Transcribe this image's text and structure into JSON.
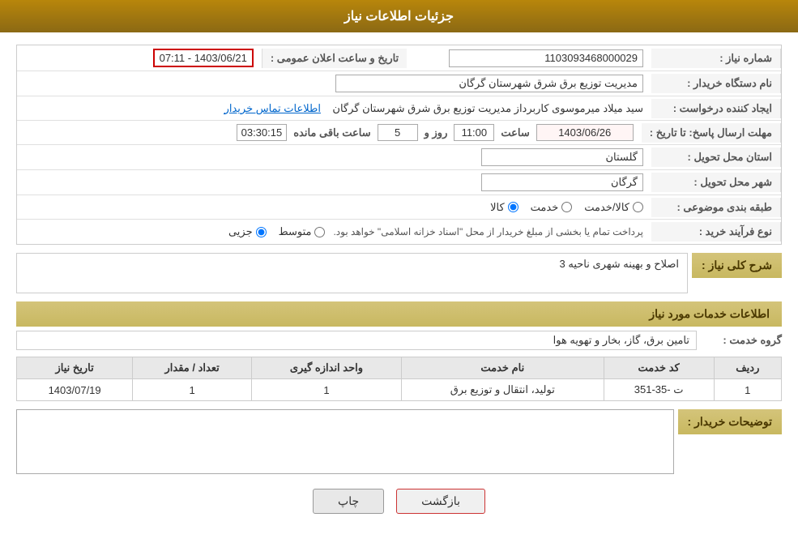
{
  "header": {
    "title": "جزئیات اطلاعات نیاز"
  },
  "fields": {
    "shomareNiaz_label": "شماره نیاز :",
    "shomareNiaz_value": "1103093468000029",
    "namDastgah_label": "نام دستگاه خریدار :",
    "namDastgah_value": "مدیریت توزیع برق شرق شهرستان گرگان",
    "ijadKonande_label": "ایجاد کننده درخواست :",
    "ijadKonande_value": "سید میلاد میرموسوی کاربرداز مدیریت توزیع برق شرق شهرستان گرگان",
    "ettelaat_label": "اطلاعات تماس خریدار",
    "mohlat_label": "مهلت ارسال پاسخ: تا تاریخ :",
    "mohlat_date": "1403/06/26",
    "mohlat_time_label": "ساعت",
    "mohlat_time": "11:00",
    "mohlat_roz_label": "روز و",
    "mohlat_roz": "5",
    "mohlat_remaining_label": "ساعت باقی مانده",
    "mohlat_remaining": "03:30:15",
    "ostan_label": "استان محل تحویل :",
    "ostan_value": "گلستان",
    "shahr_label": "شهر محل تحویل :",
    "shahr_value": "گرگان",
    "tabaqe_label": "طبقه بندی موضوعی :",
    "tabaqe_kala": "کالا",
    "tabaqe_khadamat": "خدمت",
    "tabaqe_kala_khadamat": "کالا/خدمت",
    "noeFarayand_label": "نوع فرآیند خرید :",
    "noeFarayand_jozi": "جزیی",
    "noeFarayand_motovaset": "متوسط",
    "noeFarayand_note": "پرداخت تمام یا بخشی از مبلغ خریدار از محل \"اسناد خزانه اسلامی\" خواهد بود.",
    "sharh_label": "شرح کلی نیاز :",
    "sharh_value": "اصلاح و بهینه شهری ناحیه 3",
    "khadamat_section": "اطلاعات خدمات مورد نیاز",
    "groheKhadamat_label": "گروه خدمت :",
    "groheKhadamat_value": "تامین برق، گاز، بخار و تهویه هوا",
    "table": {
      "headers": [
        "ردیف",
        "کد خدمت",
        "نام خدمت",
        "واحد اندازه گیری",
        "تعداد / مقدار",
        "تاریخ نیاز"
      ],
      "rows": [
        {
          "radif": "1",
          "kod": "ت -35-351",
          "nam": "تولید، انتقال و توزیع برق",
          "vahed": "1",
          "tedad": "1",
          "tarikh": "1403/07/19"
        }
      ]
    },
    "toseef_label": "توضیحات خریدار :",
    "toseef_value": ""
  },
  "buttons": {
    "print_label": "چاپ",
    "back_label": "بازگشت"
  }
}
